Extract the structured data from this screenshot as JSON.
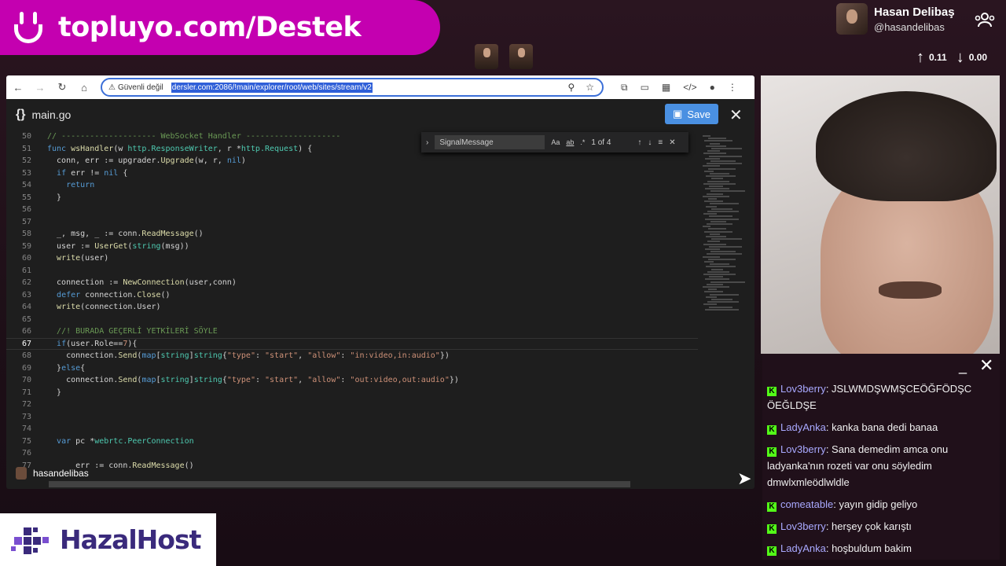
{
  "banner": {
    "text": "topluyo.com/Destek"
  },
  "profile": {
    "name": "Hasan Delibaş",
    "handle": "@hasandelibas"
  },
  "netstats": {
    "up": "0.11",
    "down": "0.00"
  },
  "browser": {
    "security_label": "Güvenli değil",
    "url": "dersler.com:2086/!main/explorer/root/web/sites/stream/v2"
  },
  "editor": {
    "filename": "main.go",
    "save_label": "Save",
    "find": {
      "query": "SignalMessage",
      "count": "1 of 4",
      "case_label": "Aa",
      "word_label": "ab",
      "regex_label": ".*"
    },
    "lines": [
      {
        "n": "50",
        "html": "<span class='c'>// -------------------- WebSocket Handler --------------------</span>"
      },
      {
        "n": "51",
        "html": "<span class='k'>func</span> <span class='f'>wsHandler</span>(w <span class='t'>http.ResponseWriter</span>, r *<span class='t'>http.Request</span>) {"
      },
      {
        "n": "52",
        "html": "  conn, err := upgrader.<span class='f'>Upgrade</span>(w, r, <span class='k'>nil</span>)"
      },
      {
        "n": "53",
        "html": "  <span class='k'>if</span> err != <span class='k'>nil</span> {"
      },
      {
        "n": "54",
        "html": "    <span class='k'>return</span>"
      },
      {
        "n": "55",
        "html": "  }"
      },
      {
        "n": "56",
        "html": ""
      },
      {
        "n": "57",
        "html": ""
      },
      {
        "n": "58",
        "html": "  _, msg, _ := conn.<span class='f'>ReadMessage</span>()"
      },
      {
        "n": "59",
        "html": "  user := <span class='f'>UserGet</span>(<span class='t'>string</span>(msg))"
      },
      {
        "n": "60",
        "html": "  <span class='f'>write</span>(user)"
      },
      {
        "n": "61",
        "html": ""
      },
      {
        "n": "62",
        "html": "  connection := <span class='f'>NewConnection</span>(user,conn)"
      },
      {
        "n": "63",
        "html": "  <span class='k'>defer</span> connection.<span class='f'>Close</span>()"
      },
      {
        "n": "64",
        "html": "  <span class='f'>write</span>(connection.User)"
      },
      {
        "n": "65",
        "html": ""
      },
      {
        "n": "66",
        "html": "  <span class='c'>//! BURADA GEÇERLİ YETKİLERİ SÖYLE</span>"
      },
      {
        "n": "67",
        "html": "  <span class='k'>if</span>(user.Role==<span class='s'>7</span>){",
        "current": true
      },
      {
        "n": "68",
        "html": "    connection.<span class='f'>Send</span>(<span class='k'>map</span>[<span class='t'>string</span>]<span class='t'>string</span>{<span class='s'>\"type\"</span>: <span class='s'>\"start\"</span>, <span class='s'>\"allow\"</span>: <span class='s'>\"in:video,in:audio\"</span>})"
      },
      {
        "n": "69",
        "html": "  }<span class='k'>else</span>{"
      },
      {
        "n": "70",
        "html": "    connection.<span class='f'>Send</span>(<span class='k'>map</span>[<span class='t'>string</span>]<span class='t'>string</span>{<span class='s'>\"type\"</span>: <span class='s'>\"start\"</span>, <span class='s'>\"allow\"</span>: <span class='s'>\"out:video,out:audio\"</span>})"
      },
      {
        "n": "71",
        "html": "  }"
      },
      {
        "n": "72",
        "html": ""
      },
      {
        "n": "73",
        "html": ""
      },
      {
        "n": "74",
        "html": ""
      },
      {
        "n": "75",
        "html": "  <span class='k'>var</span> pc *<span class='t'>webrtc.PeerConnection</span>"
      },
      {
        "n": "76",
        "html": ""
      },
      {
        "n": "77",
        "html": "      err := conn.<span class='f'>ReadMessage</span>()"
      }
    ]
  },
  "streamer_label": "hasandelibas",
  "chat": {
    "minimize": "_",
    "close": "✕",
    "messages": [
      {
        "user": "Lov3berry",
        "text": "JSLWMDŞWMŞCEÖĞFÖDŞC ÖEĞLDŞE"
      },
      {
        "user": "LadyAnka",
        "text": "kanka bana dedi banaa"
      },
      {
        "user": "Lov3berry",
        "text": "Sana demedim amca onu ladyanka'nın rozeti var onu söyledim dmwlxmleödlwldle"
      },
      {
        "user": "comeatable",
        "text": "yayın gidip geliyo"
      },
      {
        "user": "Lov3berry",
        "text": "herşey çok karıştı"
      },
      {
        "user": "LadyAnka",
        "text": "hoşbuldum bakim"
      }
    ]
  },
  "sponsor": {
    "text": "HazalHost"
  }
}
